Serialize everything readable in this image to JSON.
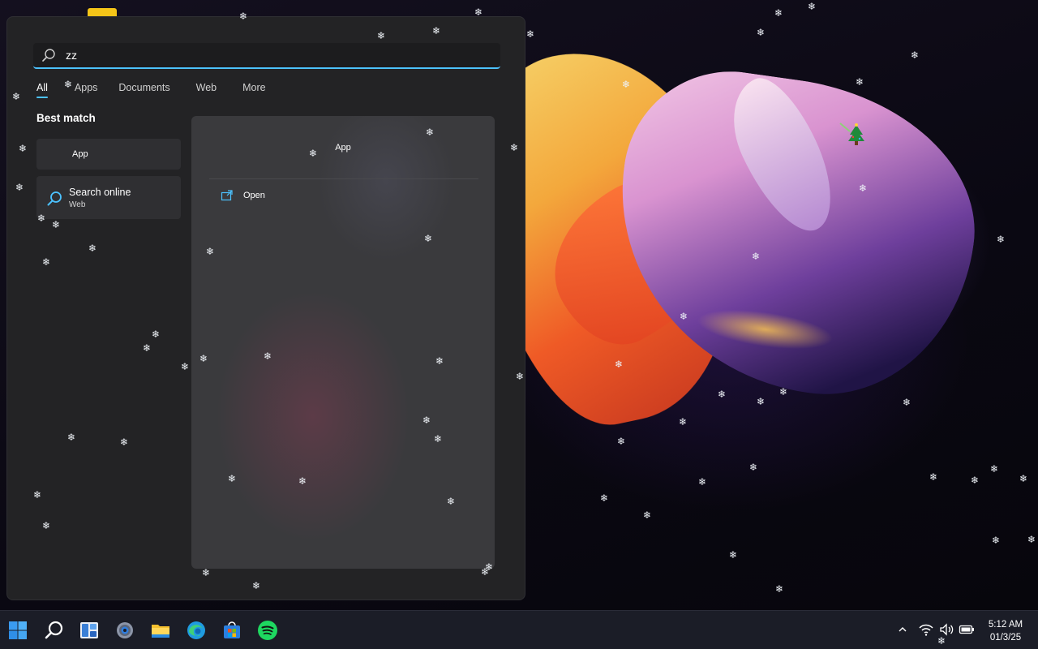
{
  "search": {
    "query": "zz",
    "icon": "search-icon",
    "accent_color": "#4cc2ff"
  },
  "filter_tabs": [
    {
      "label": "All",
      "active": true
    },
    {
      "label": "Apps",
      "active": false
    },
    {
      "label": "Documents",
      "active": false
    },
    {
      "label": "Web",
      "active": false
    },
    {
      "label": "More",
      "active": false
    }
  ],
  "best_match": {
    "heading": "Best match",
    "app_result_label": "App",
    "web_result": {
      "title": "Search online",
      "subtitle": "Web",
      "icon": "search-icon"
    }
  },
  "preview": {
    "title": "App",
    "open_label": "Open",
    "open_icon": "open-external-icon"
  },
  "taskbar": {
    "icons": [
      "windows-start-icon",
      "search-icon",
      "widgets-icon",
      "settings-icon",
      "file-explorer-icon",
      "edge-icon",
      "microsoft-store-icon",
      "spotify-icon"
    ],
    "tray_icons": [
      "chevron-up-icon",
      "wifi-icon",
      "volume-icon",
      "battery-icon"
    ],
    "clock": {
      "time": "5:12 AM",
      "date": "01/3/25"
    }
  },
  "colors": {
    "panel_background": "#232325",
    "card_background": "#2f2f32",
    "taskbar_background": "#1b1d27"
  }
}
